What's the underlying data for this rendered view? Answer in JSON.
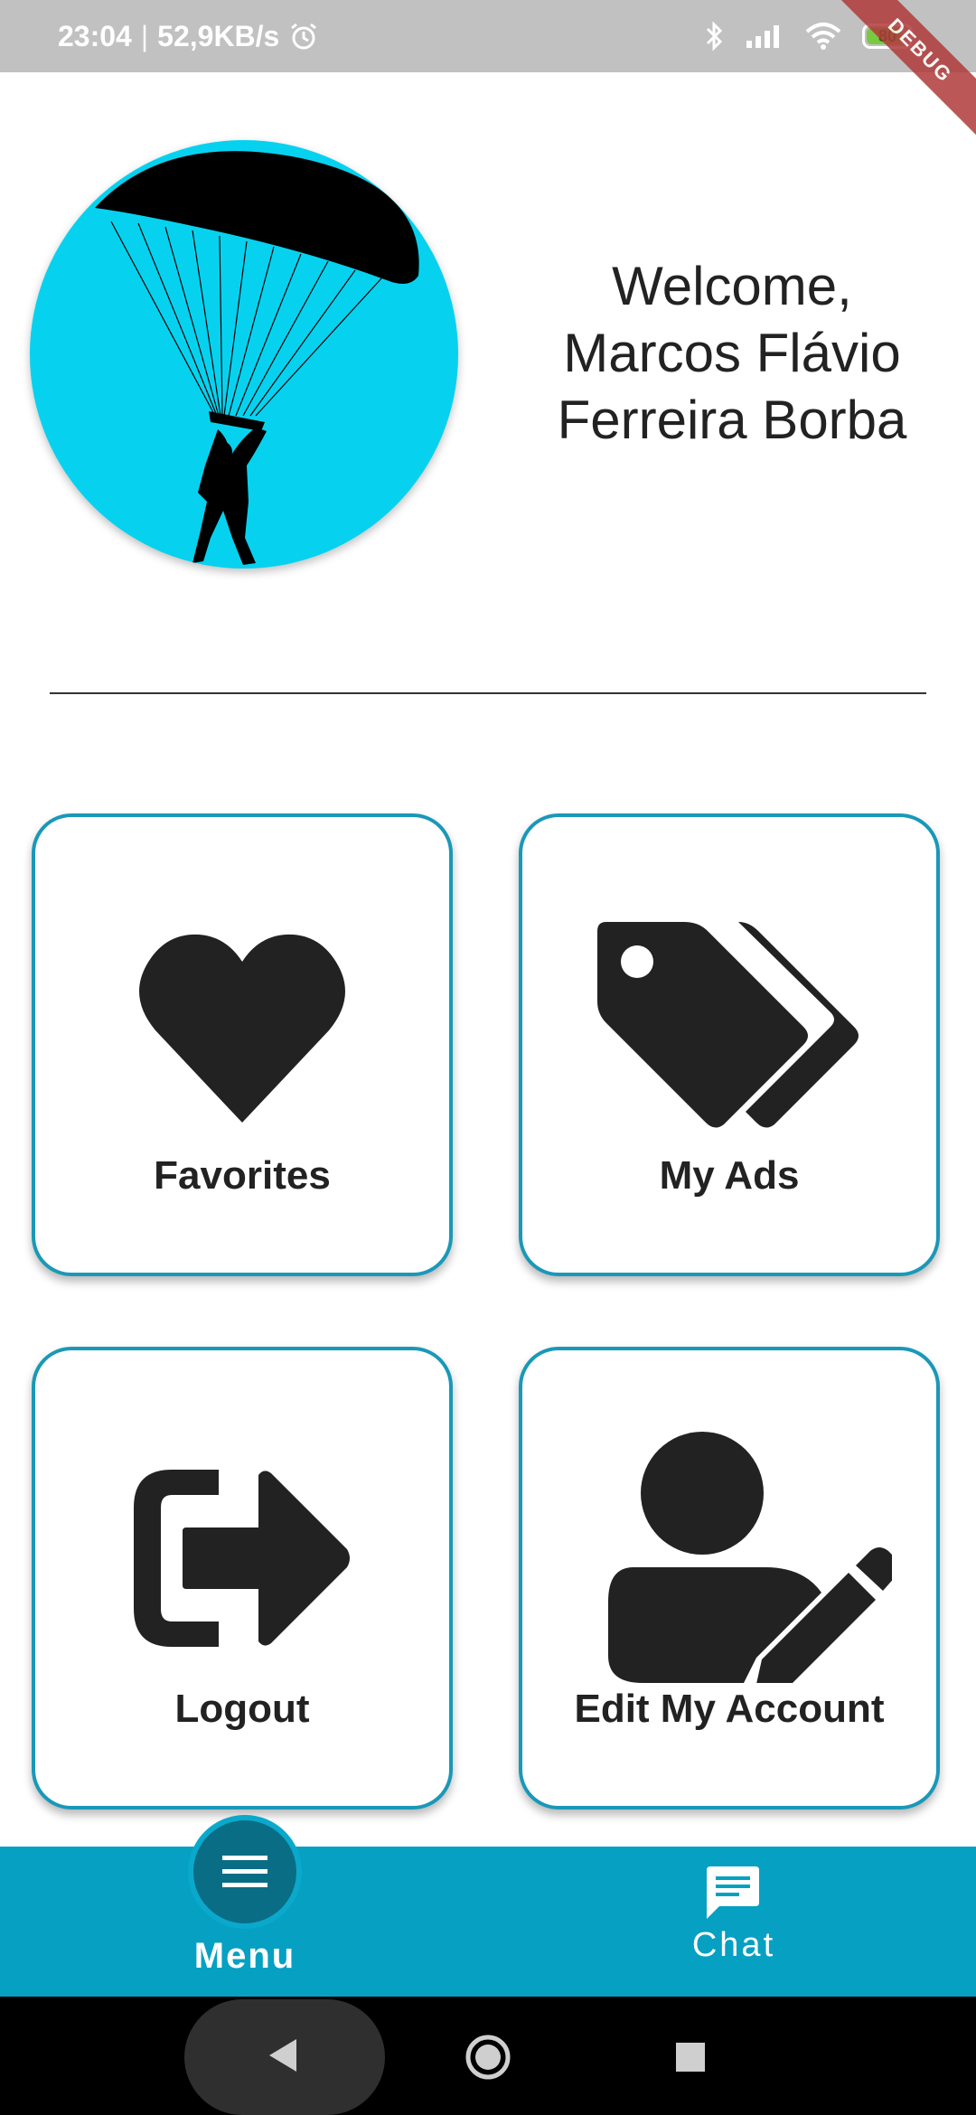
{
  "status_bar": {
    "time": "23:04",
    "net_speed": "52,9KB/s",
    "battery": "80",
    "debug_banner": "DEBUG"
  },
  "header": {
    "welcome": "Welcome,",
    "name_line1": "Marcos Flávio",
    "name_line2": "Ferreira Borba"
  },
  "tiles": [
    {
      "label": "Favorites",
      "icon": "heart-icon"
    },
    {
      "label": "My Ads",
      "icon": "tags-icon"
    },
    {
      "label": "Logout",
      "icon": "logout-icon"
    },
    {
      "label": "Edit My Account",
      "icon": "user-edit-icon"
    }
  ],
  "bottom_nav": {
    "menu_label": "Menu",
    "chat_label": "Chat"
  },
  "colors": {
    "accent": "#06a0c3",
    "tile_border": "#1a98b8",
    "avatar_bg": "#06d2ef",
    "menu_button": "#0a6d86"
  }
}
